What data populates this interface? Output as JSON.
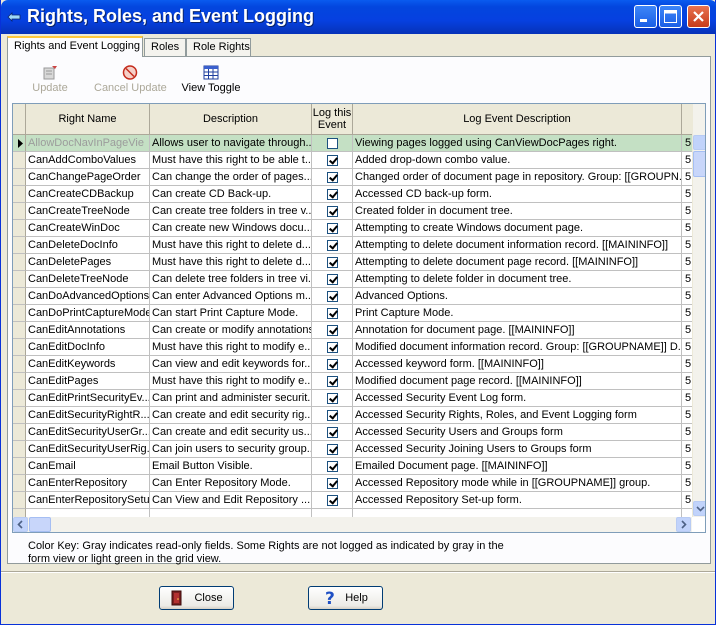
{
  "window": {
    "title": "Rights, Roles, and Event Logging"
  },
  "tabs": [
    "Rights and Event Logging",
    "Roles",
    "Role Rights"
  ],
  "toolbar": {
    "update": "Update",
    "cancel_update": "Cancel Update",
    "view_toggle": "View Toggle"
  },
  "grid": {
    "columns": [
      "Right Name",
      "Description",
      "Log this Event",
      "Log Event Description"
    ],
    "rows": [
      {
        "name": "AllowDocNavInPageVie",
        "desc": "Allows user to navigate through...",
        "logged": false,
        "log_desc": "Viewing pages logged using CanViewDocPages right.",
        "extra": "5",
        "selected": true
      },
      {
        "name": "CanAddComboValues",
        "desc": "Must have this right to be able t...",
        "logged": true,
        "log_desc": "Added drop-down combo value.",
        "extra": "5"
      },
      {
        "name": "CanChangePageOrder",
        "desc": "Can change the order of pages...",
        "logged": true,
        "log_desc": "Changed order of document page in repository. Group: [[GROUPN...",
        "extra": "5"
      },
      {
        "name": "CanCreateCDBackup",
        "desc": "Can create CD Back-up.",
        "logged": true,
        "log_desc": "Accessed CD back-up form.",
        "extra": "5"
      },
      {
        "name": "CanCreateTreeNode",
        "desc": "Can create tree folders in tree v...",
        "logged": true,
        "log_desc": "Created folder in document tree.",
        "extra": "5"
      },
      {
        "name": "CanCreateWinDoc",
        "desc": "Can create new Windows docu...",
        "logged": true,
        "log_desc": "Attempting to create Windows document page.",
        "extra": "5"
      },
      {
        "name": "CanDeleteDocInfo",
        "desc": "Must have this right to delete d...",
        "logged": true,
        "log_desc": "Attempting to delete document information record. [[MAININFO]]",
        "extra": "5"
      },
      {
        "name": "CanDeletePages",
        "desc": "Must have this right to delete d...",
        "logged": true,
        "log_desc": "Attempting to delete document page record. [[MAININFO]]",
        "extra": "5"
      },
      {
        "name": "CanDeleteTreeNode",
        "desc": "Can delete tree folders in tree vi...",
        "logged": true,
        "log_desc": "Attempting to delete folder in document tree.",
        "extra": "5"
      },
      {
        "name": "CanDoAdvancedOptions",
        "desc": "Can enter Advanced Options m...",
        "logged": true,
        "log_desc": "Advanced Options.",
        "extra": "5"
      },
      {
        "name": "CanDoPrintCaptureMode",
        "desc": "Can start Print Capture Mode.",
        "logged": true,
        "log_desc": "Print Capture Mode.",
        "extra": "5"
      },
      {
        "name": "CanEditAnnotations",
        "desc": "Can create or modify annotations...",
        "logged": true,
        "log_desc": "Annotation for document page. [[MAININFO]]",
        "extra": "5"
      },
      {
        "name": "CanEditDocInfo",
        "desc": "Must have this right to modify e...",
        "logged": true,
        "log_desc": "Modified document information record. Group: [[GROUPNAME]]  D...",
        "extra": "5"
      },
      {
        "name": "CanEditKeywords",
        "desc": "Can view and edit keywords for...",
        "logged": true,
        "log_desc": "Accessed keyword form. [[MAININFO]]",
        "extra": "5"
      },
      {
        "name": "CanEditPages",
        "desc": "Must have this right to modify e...",
        "logged": true,
        "log_desc": "Modified document page record. [[MAININFO]]",
        "extra": "5"
      },
      {
        "name": "CanEditPrintSecurityEv...",
        "desc": "Can print and administer securit...",
        "logged": true,
        "log_desc": "Accessed Security Event Log form.",
        "extra": "5"
      },
      {
        "name": "CanEditSecurityRightR...",
        "desc": "Can create and edit security rig...",
        "logged": true,
        "log_desc": "Accessed Security Rights, Roles, and Event Logging form",
        "extra": "5"
      },
      {
        "name": "CanEditSecurityUserGr...",
        "desc": "Can create and edit security us...",
        "logged": true,
        "log_desc": "Accessed Security Users and Groups form",
        "extra": "5"
      },
      {
        "name": "CanEditSecurityUserRig...",
        "desc": "Can join users to security group...",
        "logged": true,
        "log_desc": "Accessed Security Joining Users to Groups form",
        "extra": "5"
      },
      {
        "name": "CanEmail",
        "desc": "Email Button Visible.",
        "logged": true,
        "log_desc": "Emailed Document page. [[MAININFO]]",
        "extra": "5"
      },
      {
        "name": "CanEnterRepository",
        "desc": "Can Enter Repository Mode.",
        "logged": true,
        "log_desc": "Accessed Repository mode while in [[GROUPNAME]] group.",
        "extra": "5"
      },
      {
        "name": "CanEnterRepositorySetup",
        "desc": "Can View and Edit Repository ...",
        "logged": true,
        "log_desc": "Accessed Repository Set-up form.",
        "extra": "5"
      },
      {
        "name": "",
        "desc": "",
        "logged": false,
        "log_desc": "",
        "extra": ""
      }
    ]
  },
  "color_key": "Color Key: Gray indicates read-only fields.  Some Rights are not logged as indicated by gray in the form view or light green in the grid view.",
  "buttons": {
    "close": "Close",
    "help": "Help"
  }
}
